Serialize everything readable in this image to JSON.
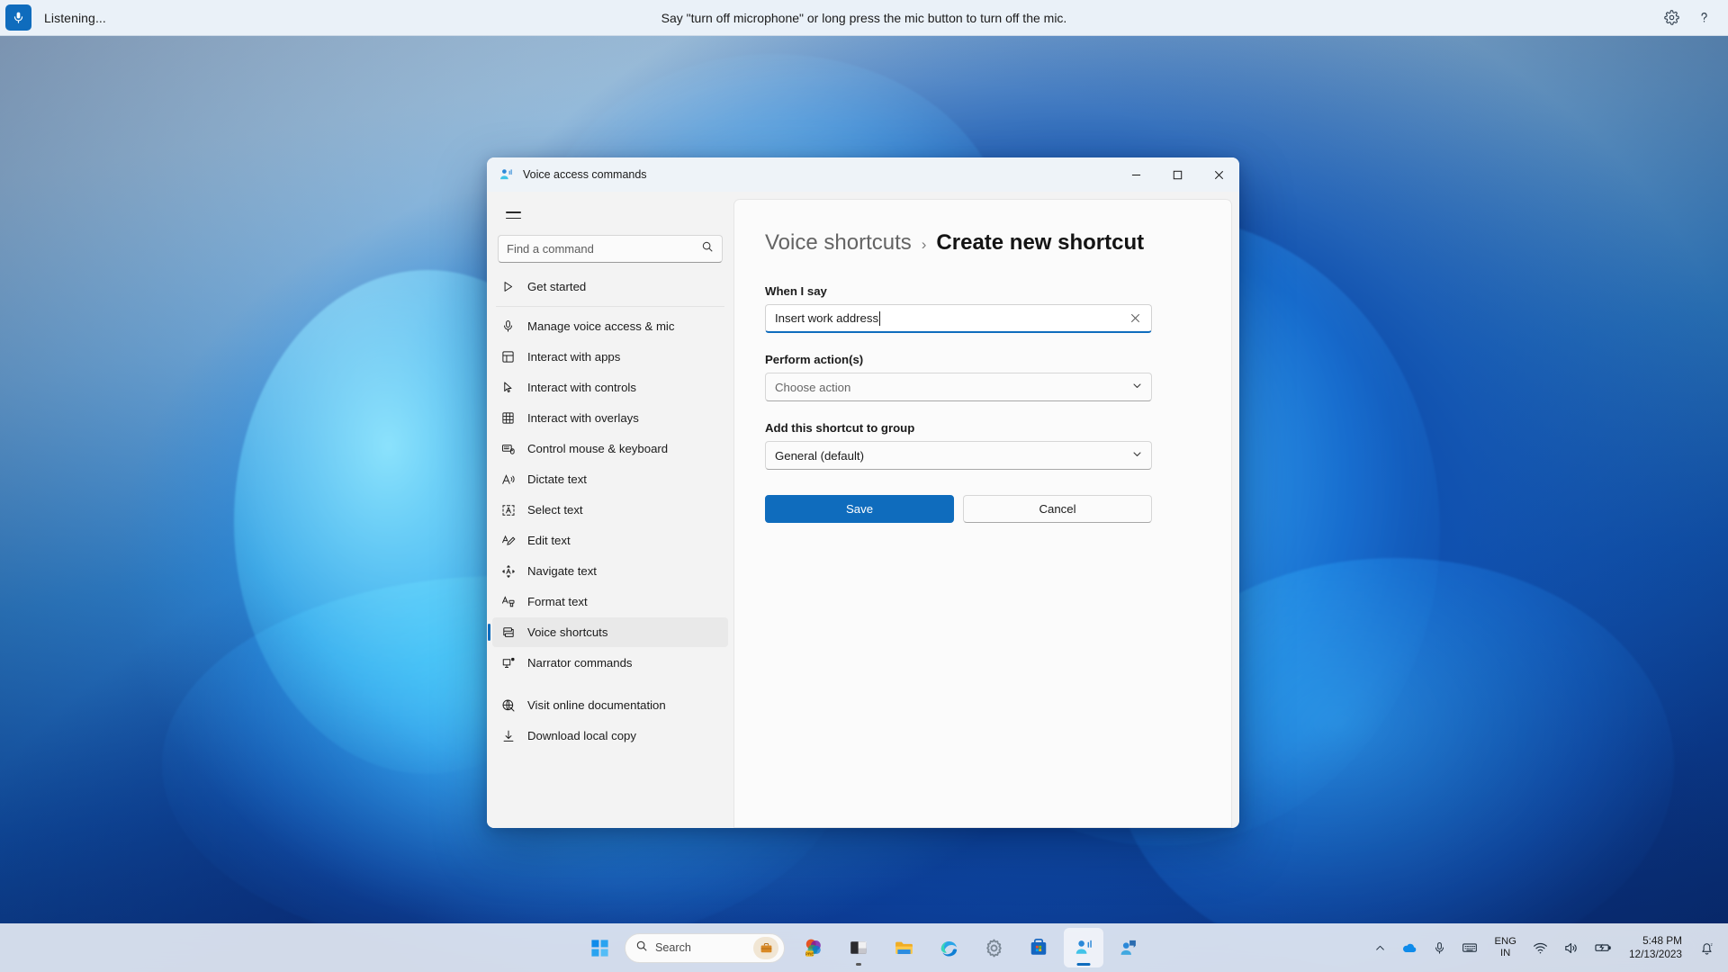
{
  "voice_access_bar": {
    "mic_icon": "microphone-icon",
    "status": "Listening...",
    "hint": "Say \"turn off microphone\" or long press the mic button to turn off the mic.",
    "settings_icon": "gear-icon",
    "help_icon": "question-mark-icon",
    "background_color": "#eaf1f8",
    "mic_button_color": "#0f6cbd"
  },
  "window": {
    "title": "Voice access commands",
    "app_icon": "voice-access-icon",
    "controls": {
      "minimize": "–",
      "maximize": "☐",
      "close": "✕"
    }
  },
  "sidebar": {
    "menu_icon": "hamburger-icon",
    "search": {
      "placeholder": "Find a command",
      "value": "",
      "icon": "search-icon"
    },
    "items": [
      {
        "label": "Get started",
        "icon": "play-triangle-icon",
        "selected": false
      },
      {
        "label": "Manage voice access & mic",
        "icon": "microphone-icon",
        "selected": false
      },
      {
        "label": "Interact with apps",
        "icon": "apps-grid-icon",
        "selected": false
      },
      {
        "label": "Interact with controls",
        "icon": "cursor-arrow-icon",
        "selected": false
      },
      {
        "label": "Interact with overlays",
        "icon": "grid-overlay-icon",
        "selected": false
      },
      {
        "label": "Control mouse & keyboard",
        "icon": "keyboard-mouse-icon",
        "selected": false
      },
      {
        "label": "Dictate text",
        "icon": "dictate-a-icon",
        "selected": false
      },
      {
        "label": "Select text",
        "icon": "select-text-icon",
        "selected": false
      },
      {
        "label": "Edit text",
        "icon": "edit-pencil-icon",
        "selected": false
      },
      {
        "label": "Navigate text",
        "icon": "navigate-move-icon",
        "selected": false
      },
      {
        "label": "Format text",
        "icon": "format-brush-icon",
        "selected": false
      },
      {
        "label": "Voice shortcuts",
        "icon": "shortcuts-stack-icon",
        "selected": true
      },
      {
        "label": "Narrator commands",
        "icon": "narrator-icon",
        "selected": false
      }
    ],
    "footer_items": [
      {
        "label": "Visit online documentation",
        "icon": "globe-icon"
      },
      {
        "label": "Download local copy",
        "icon": "download-arrow-icon"
      }
    ],
    "selection_accent": "#0f6cbd"
  },
  "main": {
    "breadcrumb": {
      "root": "Voice shortcuts",
      "separator": "›",
      "current": "Create new shortcut"
    },
    "fields": {
      "when_i_say": {
        "label": "When I say",
        "value": "Insert work address",
        "clear_icon": "close-x-icon",
        "focused": true,
        "focus_color": "#0f6cbd"
      },
      "perform_actions": {
        "label": "Perform action(s)",
        "placeholder": "Choose action",
        "chevron_icon": "chevron-down-icon"
      },
      "add_to_group": {
        "label": "Add this shortcut to group",
        "value": "General (default)",
        "chevron_icon": "chevron-down-icon"
      }
    },
    "buttons": {
      "save": "Save",
      "cancel": "Cancel",
      "save_color": "#0f6cbd"
    }
  },
  "taskbar": {
    "start_icon": "windows-start-icon",
    "search": {
      "icon": "search-icon",
      "label": "Search",
      "badge_icon": "briefcase-icon"
    },
    "apps": [
      {
        "name": "microsoft-365-icon",
        "running": false,
        "active": false
      },
      {
        "name": "file-explorer-dark-icon",
        "running": true,
        "active": false
      },
      {
        "name": "file-explorer-icon",
        "running": false,
        "active": false
      },
      {
        "name": "edge-browser-icon",
        "running": false,
        "active": false
      },
      {
        "name": "settings-gear-icon",
        "running": false,
        "active": false
      },
      {
        "name": "microsoft-store-icon",
        "running": false,
        "active": false
      },
      {
        "name": "voice-access-icon",
        "running": true,
        "active": true
      },
      {
        "name": "feedback-hub-icon",
        "running": false,
        "active": false
      }
    ],
    "tray": {
      "chevron_icon": "chevron-up-icon",
      "onedrive_icon": "cloud-icon",
      "mic_icon": "microphone-icon",
      "keyboard_icon": "keyboard-icon",
      "language_primary": "ENG",
      "language_secondary": "IN",
      "wifi_icon": "wifi-icon",
      "volume_icon": "speaker-icon",
      "battery_icon": "battery-charging-icon",
      "time": "5:48 PM",
      "date": "12/13/2023",
      "notification_icon": "notification-bell-icon"
    }
  }
}
